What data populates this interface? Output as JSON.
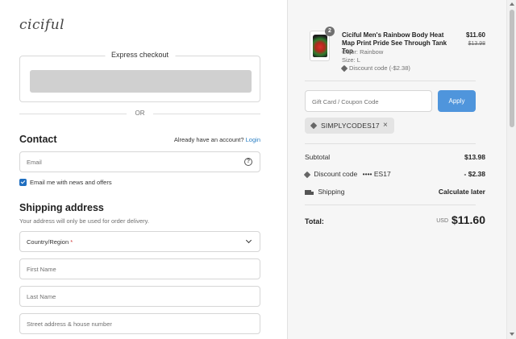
{
  "brand": {
    "logo_text": "ciciful"
  },
  "express": {
    "title": "Express checkout",
    "or_text": "OR"
  },
  "contact": {
    "heading": "Contact",
    "account_prompt": "Already have an account?",
    "login_link": "Login",
    "email_placeholder": "Email",
    "newsletter_label": "Email me with news and offers",
    "newsletter_checked": true
  },
  "shipping": {
    "heading": "Shipping address",
    "note": "Your address will only be used for order delivery.",
    "country_placeholder": "Country/Region",
    "required_mark": "*",
    "first_name_placeholder": "First Name",
    "last_name_placeholder": "Last Name",
    "street_placeholder": "Street address & house number"
  },
  "order": {
    "product": {
      "title": "Ciciful Men's Rainbow Body Heat Map Print Pride See Through Tank Top",
      "color": "Color: Rainbow",
      "size": "Size: L",
      "discount": "Discount code (-$2.38)",
      "price": "$11.60",
      "compare_price": "$13.98",
      "quantity": "2"
    },
    "gift_placeholder": "Gift Card / Coupon Code",
    "apply_label": "Apply",
    "applied_code": "SIMPLYCODES17",
    "remove_symbol": "×",
    "subtotal_label": "Subtotal",
    "subtotal_value": "$13.98",
    "discount_label": "Discount code",
    "discount_masked": "•••• ES17",
    "discount_value": "- $2.38",
    "shipping_label": "Shipping",
    "shipping_value": "Calculate later",
    "total_label": "Total:",
    "total_currency": "USD",
    "total_value": "$11.60"
  },
  "colors": {
    "accent": "#4f95dc",
    "link": "#2a7fc4",
    "checkbox": "#1f6ec0"
  }
}
